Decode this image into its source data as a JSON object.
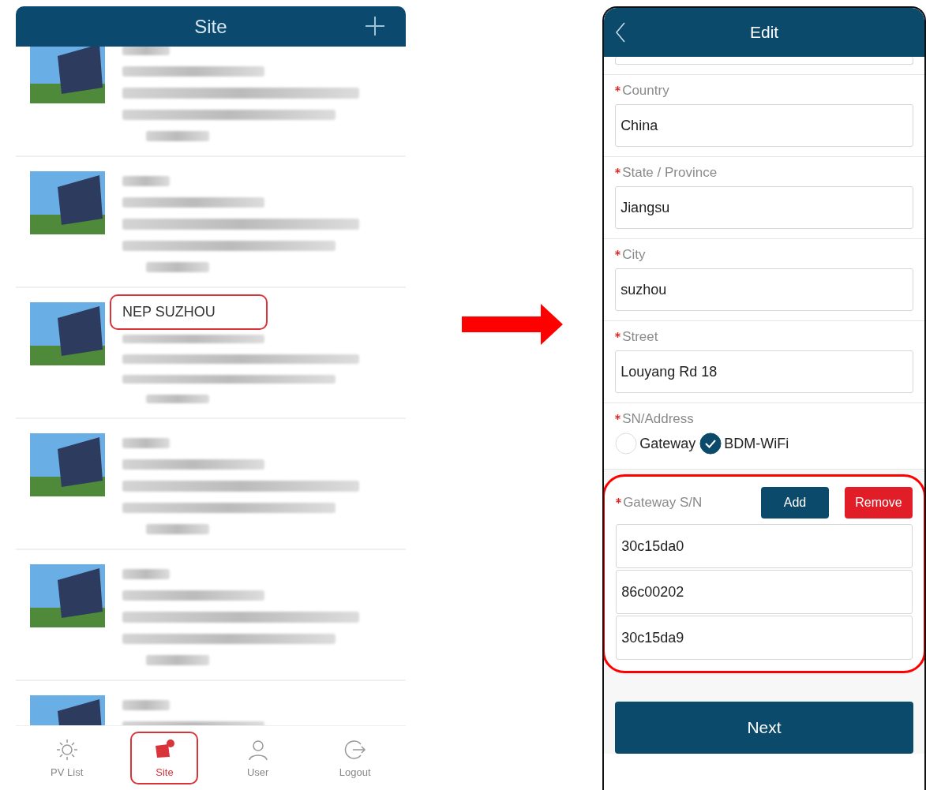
{
  "site_screen": {
    "title": "Site",
    "sites": [
      {
        "highlighted": false
      },
      {
        "highlighted": false
      },
      {
        "name": "NEP SUZHOU",
        "highlighted": true
      },
      {
        "highlighted": false
      },
      {
        "highlighted": false
      },
      {
        "highlighted": false
      }
    ],
    "tabs": [
      {
        "label": "PV List",
        "kind": "sun",
        "selected": false
      },
      {
        "label": "Site",
        "kind": "site",
        "selected": true
      },
      {
        "label": "User",
        "kind": "user",
        "selected": false
      },
      {
        "label": "Logout",
        "kind": "logout",
        "selected": false
      }
    ]
  },
  "edit_screen": {
    "title": "Edit",
    "fields": [
      {
        "label": "Country",
        "value": "China",
        "required": true
      },
      {
        "label": "State / Province",
        "value": "Jiangsu",
        "required": true
      },
      {
        "label": "City",
        "value": "suzhou",
        "required": true
      },
      {
        "label": "Street",
        "value": "Louyang Rd 18",
        "required": true
      }
    ],
    "sn_address": {
      "label": "SN/Address",
      "required": true,
      "options": [
        {
          "label": "Gateway",
          "selected": false
        },
        {
          "label": "BDM-WiFi",
          "selected": true
        }
      ]
    },
    "gateway_sn": {
      "label": "Gateway S/N",
      "required": true,
      "highlighted": true,
      "add": "Add",
      "remove": "Remove",
      "values": [
        "30c15da0",
        "86c00202",
        "30c15da9"
      ]
    },
    "next": "Next"
  }
}
